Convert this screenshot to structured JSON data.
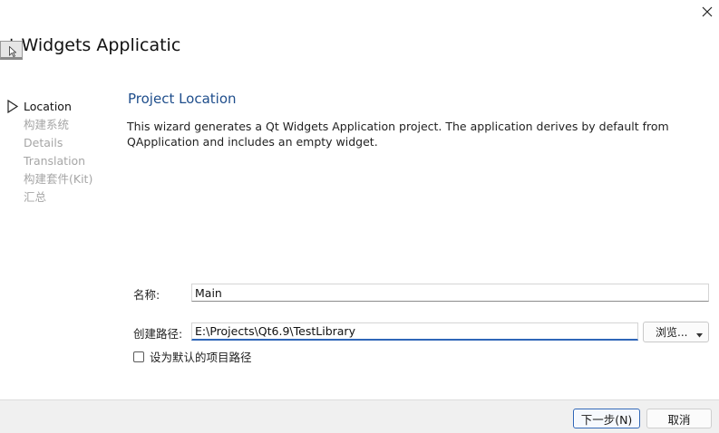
{
  "window": {
    "title": "t Widgets Applicatic",
    "close_icon": "close-icon"
  },
  "steps": [
    {
      "label": "Location",
      "active": true
    },
    {
      "label": "构建系统",
      "active": false
    },
    {
      "label": "Details",
      "active": false
    },
    {
      "label": "Translation",
      "active": false
    },
    {
      "label": "构建套件(Kit)",
      "active": false
    },
    {
      "label": "汇总",
      "active": false
    }
  ],
  "page": {
    "title": "Project Location",
    "description": "This wizard generates a Qt Widgets Application project. The application derives by default from QApplication and includes an empty widget."
  },
  "form": {
    "name_label": "名称:",
    "name_value": "Main",
    "path_label": "创建路径:",
    "path_value": "E:\\Projects\\Qt6.9\\TestLibrary",
    "browse_label": "浏览...",
    "default_path_label": "设为默认的项目路径",
    "default_path_checked": false
  },
  "footer": {
    "next_label": "下一步(N)",
    "cancel_label": "取消"
  },
  "colors": {
    "accent": "#2f66b8",
    "title_blue": "#1f4e8c",
    "inactive_step": "#a6a6a6",
    "footer_bg": "#f0f0f0"
  }
}
